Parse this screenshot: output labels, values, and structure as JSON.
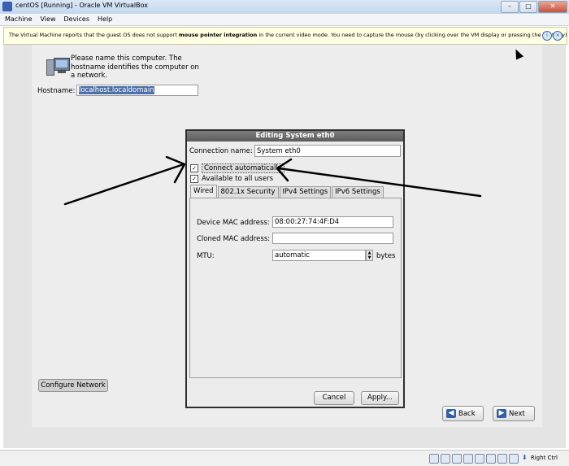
{
  "window": {
    "title": "centOS [Running] - Oracle VM VirtualBox"
  },
  "menubar": [
    "Machine",
    "View",
    "Devices",
    "Help"
  ],
  "notification": {
    "text_before": "The Virtual Machine reports that the guest OS does not support ",
    "text_bold": "mouse pointer integration",
    "text_after": " in the current video mode. You need to capture the mouse (by clicking over the VM display or pressing the host key) in order to"
  },
  "installer": {
    "intro": "Please name this computer.  The hostname identifies the computer on a network.",
    "hostname_label": "Hostname:",
    "hostname_value": "localhost.localdomain",
    "configure_network": "Configure Network",
    "back": "Back",
    "next": "Next"
  },
  "dialog": {
    "title": "Editing System eth0",
    "connection_name_label": "Connection name:",
    "connection_name_value": "System eth0",
    "connect_automatically": "Connect automatically",
    "available_to_all": "Available to all users",
    "connect_automatically_checked": true,
    "available_to_all_checked": true,
    "tabs": [
      "Wired",
      "802.1x Security",
      "IPv4 Settings",
      "IPv6 Settings"
    ],
    "active_tab": "Wired",
    "device_mac_label": "Device MAC address:",
    "device_mac_value": "08:00:27:74:4F:D4",
    "cloned_mac_label": "Cloned MAC address:",
    "cloned_mac_value": "",
    "mtu_label": "MTU:",
    "mtu_value": "automatic",
    "mtu_unit": "bytes",
    "cancel": "Cancel",
    "apply": "Apply..."
  },
  "statusbar": {
    "host_key": "Right Ctrl"
  }
}
